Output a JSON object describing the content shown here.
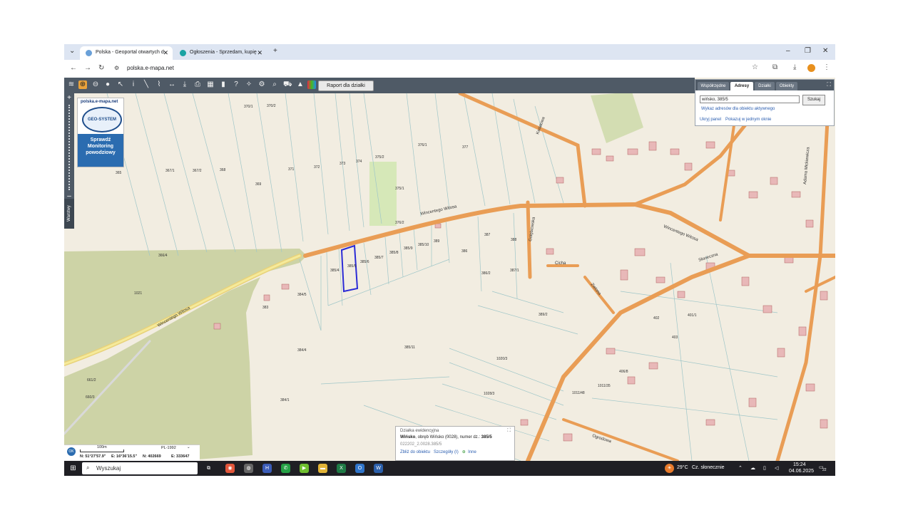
{
  "browser": {
    "tabs": [
      {
        "label": "Polska - Geoportal otwartych d",
        "active": true,
        "favicon_color": "#6aa0d8"
      },
      {
        "label": "Ogłoszenia - Sprzedam, kupię",
        "active": false,
        "favicon_color": "#1aa3a3"
      }
    ],
    "url": "polska.e-mapa.net"
  },
  "toolbar": {
    "raport_label": "Raport dla działki",
    "icons": [
      "layers-icon",
      "zoom-in-icon",
      "zoom-out-icon",
      "pan-icon",
      "pointer-icon",
      "info-icon",
      "measure-line-icon",
      "measure-area-icon",
      "distance-icon",
      "download-icon",
      "print-icon",
      "layout-icon",
      "comment-icon",
      "help-icon",
      "share-icon",
      "settings-icon",
      "search-icon",
      "cart-icon",
      "warning-icon",
      "color-icon"
    ]
  },
  "left_panel": {
    "site": "polska.e-mapa.net",
    "logo_text": "GEO-SYSTEM",
    "monitoring": "Sprawdź Monitoring powodziowy",
    "layers_label": "Warstwy"
  },
  "search_panel": {
    "tabs": [
      "Współrzędne",
      "Adresy",
      "Działki",
      "Obiekty"
    ],
    "active_tab": "Adresy",
    "input_value": "wińsko, 385/5",
    "search_button": "Szukaj",
    "link_list": "Wykaz adresów dla obiektu aktywnego",
    "link_hide": "Ukryj panel",
    "link_single": "Pokazuj w jednym oknie"
  },
  "map": {
    "streets": [
      "Wincentego Witosa",
      "Wincentego Witosa",
      "Wincentego Witosa",
      "Kwiatowa",
      "Gołębiowska",
      "Cicha",
      "Zielona",
      "Słoneczna",
      "Adama Mickiewicza",
      "Ogrodowa"
    ],
    "parcels": [
      "385/5",
      "385/4",
      "385/6",
      "385/7",
      "385/8",
      "385/9",
      "385/10",
      "385/11",
      "384/5",
      "384/4",
      "384/1",
      "386",
      "387",
      "388",
      "389",
      "370/1",
      "370/2",
      "373",
      "374",
      "375/2",
      "375/1",
      "376/1",
      "376/2",
      "377",
      "367/1",
      "367/2",
      "368",
      "369",
      "371",
      "372",
      "365",
      "366/4",
      "1021",
      "383",
      "386/2",
      "387/1",
      "389/2",
      "1028/3",
      "1020/3",
      "402",
      "403",
      "406/8",
      "401/1",
      "1011/48",
      "1011/35",
      "661/2",
      "660/3"
    ],
    "highlighted_parcel_color": "#2b2bd6"
  },
  "info_popup": {
    "title": "Działka ewidencyjna",
    "detail_bold": "Wińsko",
    "detail_rest": ", obręb Wińsko (0028), numer dz.:",
    "number": "385/5",
    "id": "022202_2.0028.385/5",
    "link_zoom": "Zbliż do obiektu",
    "link_details": "Szczegóły (I)",
    "link_other": "Inne"
  },
  "scale": {
    "label": "100m",
    "crs": "PL-1992",
    "coords_n": "N: 51°27'57.9\"",
    "coords_e": "E: 16°36'15.5\"",
    "x": "N: 402669",
    "y": "E: 333647"
  },
  "taskbar": {
    "search_placeholder": "Wyszukaj",
    "weather_temp": "29°C",
    "weather_desc": "Cz. słonecznie",
    "time": "15:24",
    "date": "04.06.2025",
    "badge": "22"
  }
}
